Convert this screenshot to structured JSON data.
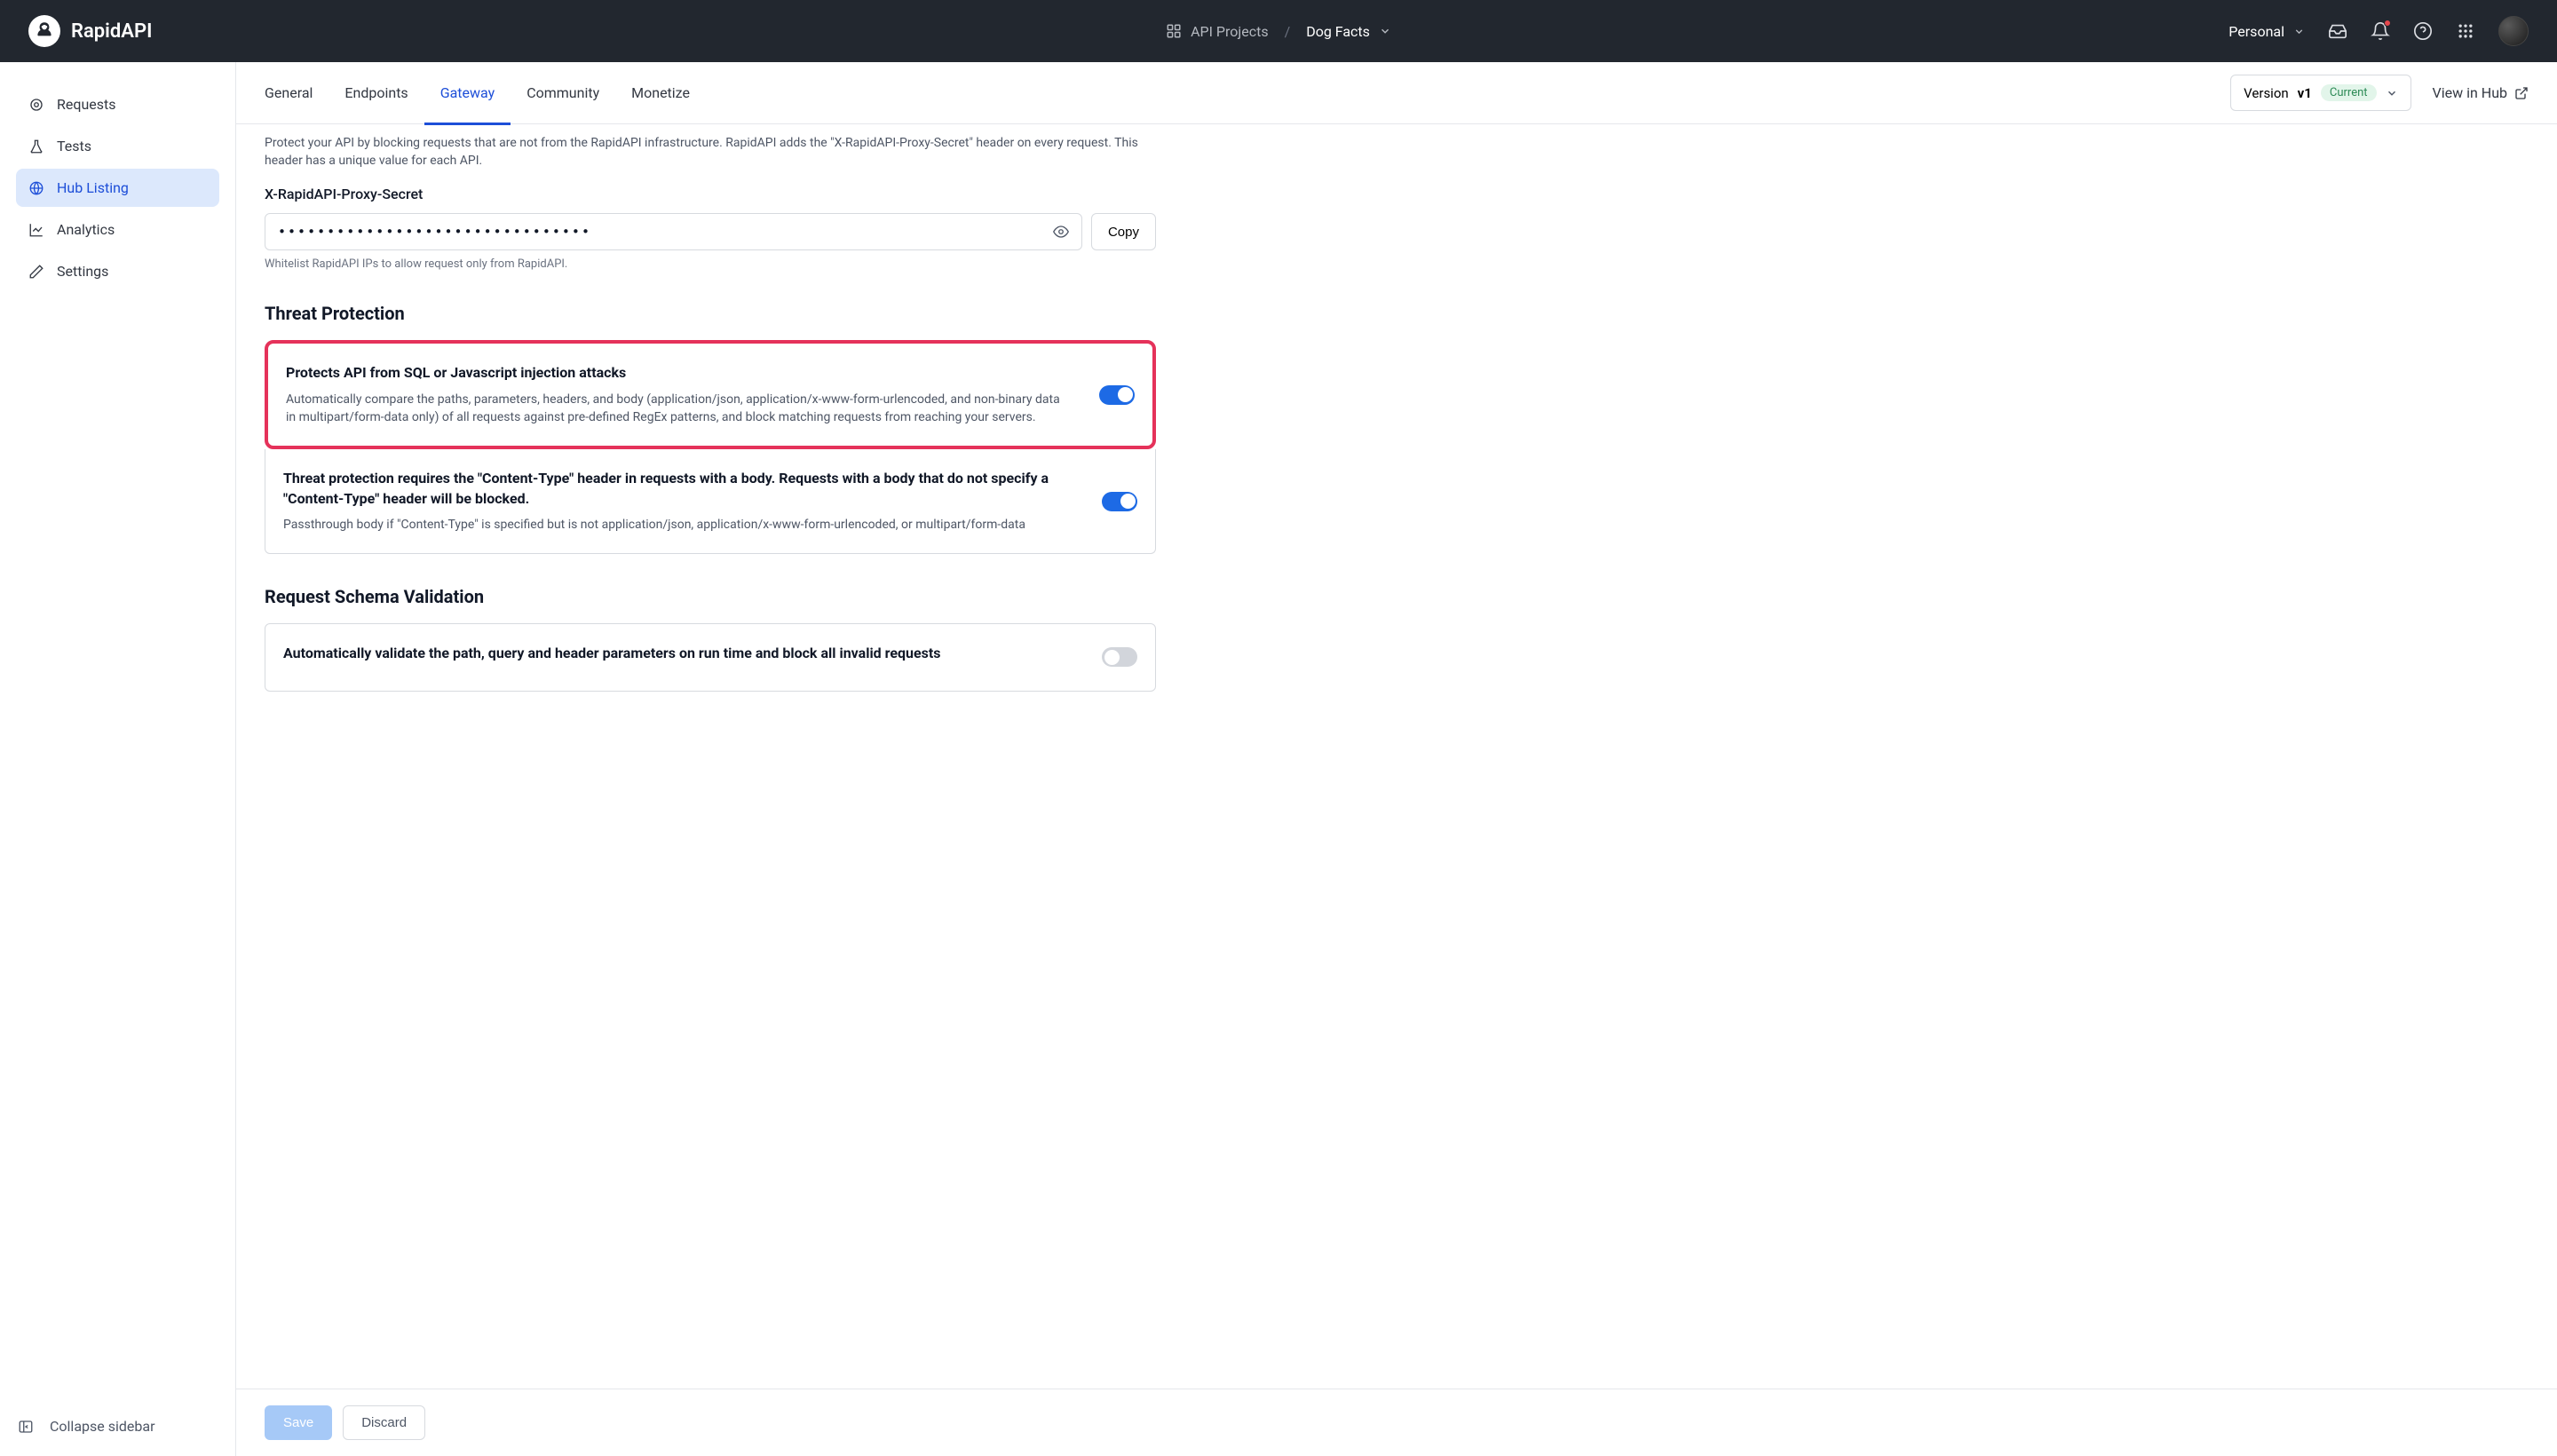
{
  "header": {
    "brand": "RapidAPI",
    "breadcrumb_root": "API Projects",
    "breadcrumb_sep": "/",
    "breadcrumb_current": "Dog Facts",
    "workspace": "Personal"
  },
  "sidebar": {
    "items": [
      {
        "label": "Requests"
      },
      {
        "label": "Tests"
      },
      {
        "label": "Hub Listing"
      },
      {
        "label": "Analytics"
      },
      {
        "label": "Settings"
      }
    ],
    "collapse": "Collapse sidebar"
  },
  "tabs": {
    "items": [
      {
        "label": "General"
      },
      {
        "label": "Endpoints"
      },
      {
        "label": "Gateway"
      },
      {
        "label": "Community"
      },
      {
        "label": "Monetize"
      }
    ],
    "version_prefix": "Version ",
    "version": "v1",
    "version_badge": "Current",
    "view_hub": "View in Hub"
  },
  "content": {
    "proxy_desc": "Protect your API by blocking requests that are not from the RapidAPI infrastructure. RapidAPI adds the \"X-RapidAPI-Proxy-Secret\" header on every request. This header has a unique value for each API.",
    "secret_label": "X-RapidAPI-Proxy-Secret",
    "secret_value": "••••••••••••••••••••••••••••••••",
    "copy": "Copy",
    "whitelist_hint": "Whitelist RapidAPI IPs to allow request only from RapidAPI.",
    "threat_title": "Threat Protection",
    "threat1_title": "Protects API from SQL or Javascript injection attacks",
    "threat1_desc": "Automatically compare the paths, parameters, headers, and body (application/json, application/x-www-form-urlencoded, and non-binary data in multipart/form-data only) of all requests against pre-defined RegEx patterns, and block matching requests from reaching your servers.",
    "threat2_title": "Threat protection requires the \"Content-Type\" header in requests with a body. Requests with a body that do not specify a \"Content-Type\" header will be blocked.",
    "threat2_desc": "Passthrough body if \"Content-Type\" is specified but is not application/json, application/x-www-form-urlencoded, or multipart/form-data",
    "schema_title": "Request Schema Validation",
    "schema1_title": "Automatically validate the path, query and header parameters on run time and block all invalid requests"
  },
  "footer": {
    "save": "Save",
    "discard": "Discard"
  }
}
